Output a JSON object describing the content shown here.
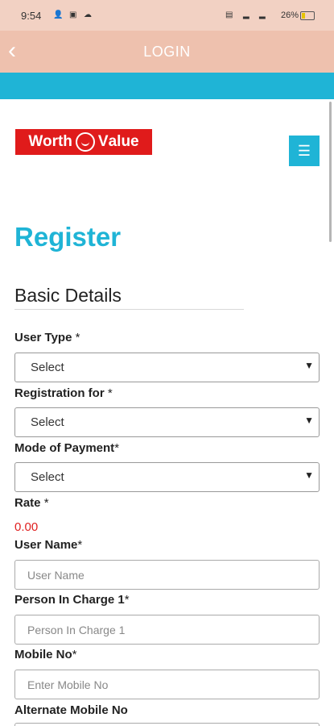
{
  "status_bar": {
    "time": "9:54",
    "battery_percent": "26%",
    "icons": [
      "person-icon",
      "message-icon",
      "cloud-icon",
      "vo-lte-icon",
      "signal-icon",
      "signal-icon",
      "battery-icon"
    ]
  },
  "app_bar": {
    "back_icon": "chevron-left-icon",
    "title": "LOGIN"
  },
  "logo": {
    "text_left": "Worth",
    "text_right": "alue"
  },
  "menu_icon": "hamburger-icon",
  "page": {
    "heading": "Register",
    "section_title": "Basic Details"
  },
  "form": {
    "user_type_label": "User Type",
    "user_type_value": "Select",
    "registration_for_label": "Registration for",
    "registration_for_value": "Select",
    "mode_of_payment_label": "Mode of Payment",
    "mode_of_payment_value": "Select",
    "rate_label": "Rate",
    "rate_value": "0.00",
    "user_name_label": "User Name",
    "user_name_placeholder": "User Name",
    "person_in_charge_label": "Person In Charge 1",
    "person_in_charge_placeholder": "Person In Charge 1",
    "mobile_no_label": "Mobile No",
    "mobile_no_placeholder": "Enter Mobile No",
    "alternate_mobile_label": "Alternate Mobile No",
    "required_mark": "*"
  },
  "colors": {
    "accent": "#1fb4d6",
    "app_bar": "#eec1ae",
    "rate": "#e02020"
  }
}
